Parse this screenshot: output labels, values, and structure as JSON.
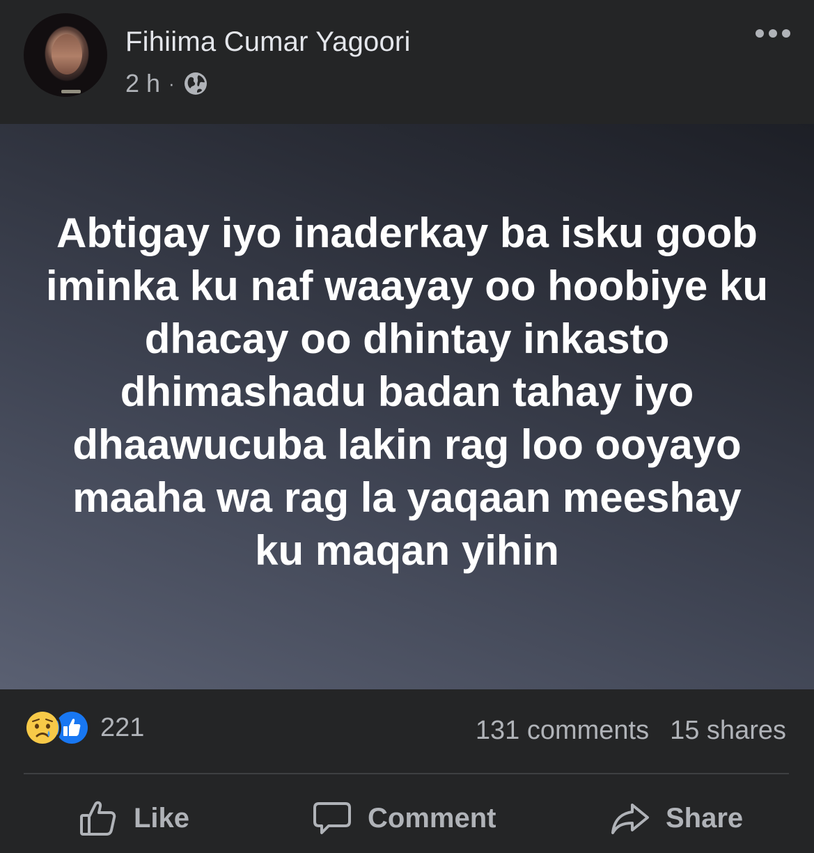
{
  "post": {
    "author": "Fihiima Cumar Yagoori",
    "time": "2 h",
    "separator": "·",
    "privacy_icon": "globe-icon",
    "more_icon": "more-options-icon",
    "text": "Abtigay iyo inaderkay ba isku goob iminka ku naf waayay oo hoobiye ku dhacay oo dhintay inkasto dhimashadu badan tahay iyo dhaawucuba lakin rag loo ooyayo maaha wa rag la yaqaan meeshay ku maqan yihin",
    "background_colors": [
      "#5a6072",
      "#3f4453",
      "#1d1f26"
    ]
  },
  "stats": {
    "reactions": [
      "sad-reaction-icon",
      "like-reaction-icon"
    ],
    "reaction_count": "221",
    "comments": "131 comments",
    "shares": "15 shares"
  },
  "actions": {
    "like": "Like",
    "comment": "Comment",
    "share": "Share"
  },
  "colors": {
    "background": "#242526",
    "primary_text": "#e4e6eb",
    "secondary_text": "#b0b3b8",
    "like_blue": "#1877f2",
    "sad_yellow": "#f7c948"
  }
}
